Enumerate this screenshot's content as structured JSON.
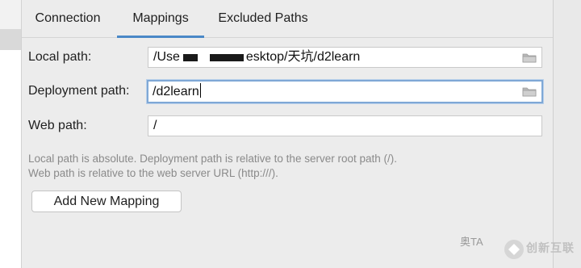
{
  "tabs": [
    {
      "label": "Connection",
      "active": false
    },
    {
      "label": "Mappings",
      "active": true
    },
    {
      "label": "Excluded Paths",
      "active": false
    }
  ],
  "form": {
    "local_path": {
      "label": "Local path:",
      "value_prefix": "/Use",
      "value_suffix": "esktop/天坑/d2learn"
    },
    "deployment_path": {
      "label": "Deployment path:",
      "value": "/d2learn"
    },
    "web_path": {
      "label": "Web path:",
      "value": "/"
    }
  },
  "hints": [
    "Local path is absolute. Deployment path is relative to the server root path (/).",
    "Web path is relative to the web server URL (http:///)."
  ],
  "add_button": {
    "label": "Add New Mapping"
  },
  "watermark": {
    "left": "奥TA",
    "brand": "创新互联"
  },
  "colors": {
    "accent": "#4a88c7",
    "focus_border": "#7fa8d6"
  },
  "icons": {
    "browse": "folder-icon"
  }
}
